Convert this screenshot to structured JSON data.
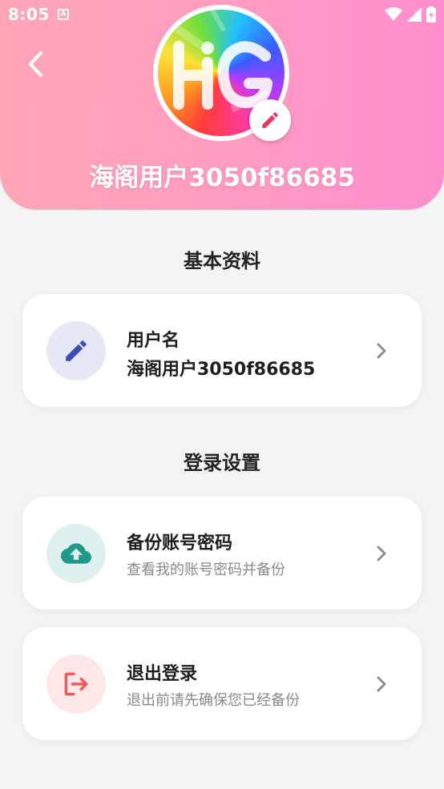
{
  "status_bar": {
    "time": "8:05",
    "notification_glyph": "A",
    "icons": [
      "wifi-icon",
      "signal-icon",
      "battery-icon"
    ]
  },
  "header": {
    "username": "海阁用户3050f86685",
    "avatar_letters": "HG",
    "colors": {
      "gradient_start": "#ffa6b6",
      "gradient_end": "#ff8fcf"
    }
  },
  "sections": {
    "basic_info": "基本资料",
    "login_settings": "登录设置"
  },
  "cards": {
    "username": {
      "title": "用户名",
      "value": "海阁用户3050f86685",
      "icon": "pencil-icon",
      "icon_color": "#3d4db7",
      "icon_bg": "#e6e8f5"
    },
    "backup": {
      "title": "备份账号密码",
      "subtitle": "查看我的账号密码并备份",
      "icon": "cloud-upload-icon",
      "icon_color": "#1f9a8a",
      "icon_bg": "#dff1ef"
    },
    "logout": {
      "title": "退出登录",
      "subtitle": "退出前请先确保您已经备份",
      "icon": "logout-icon",
      "icon_color": "#f05a5a",
      "icon_bg": "#fde7e7"
    }
  }
}
